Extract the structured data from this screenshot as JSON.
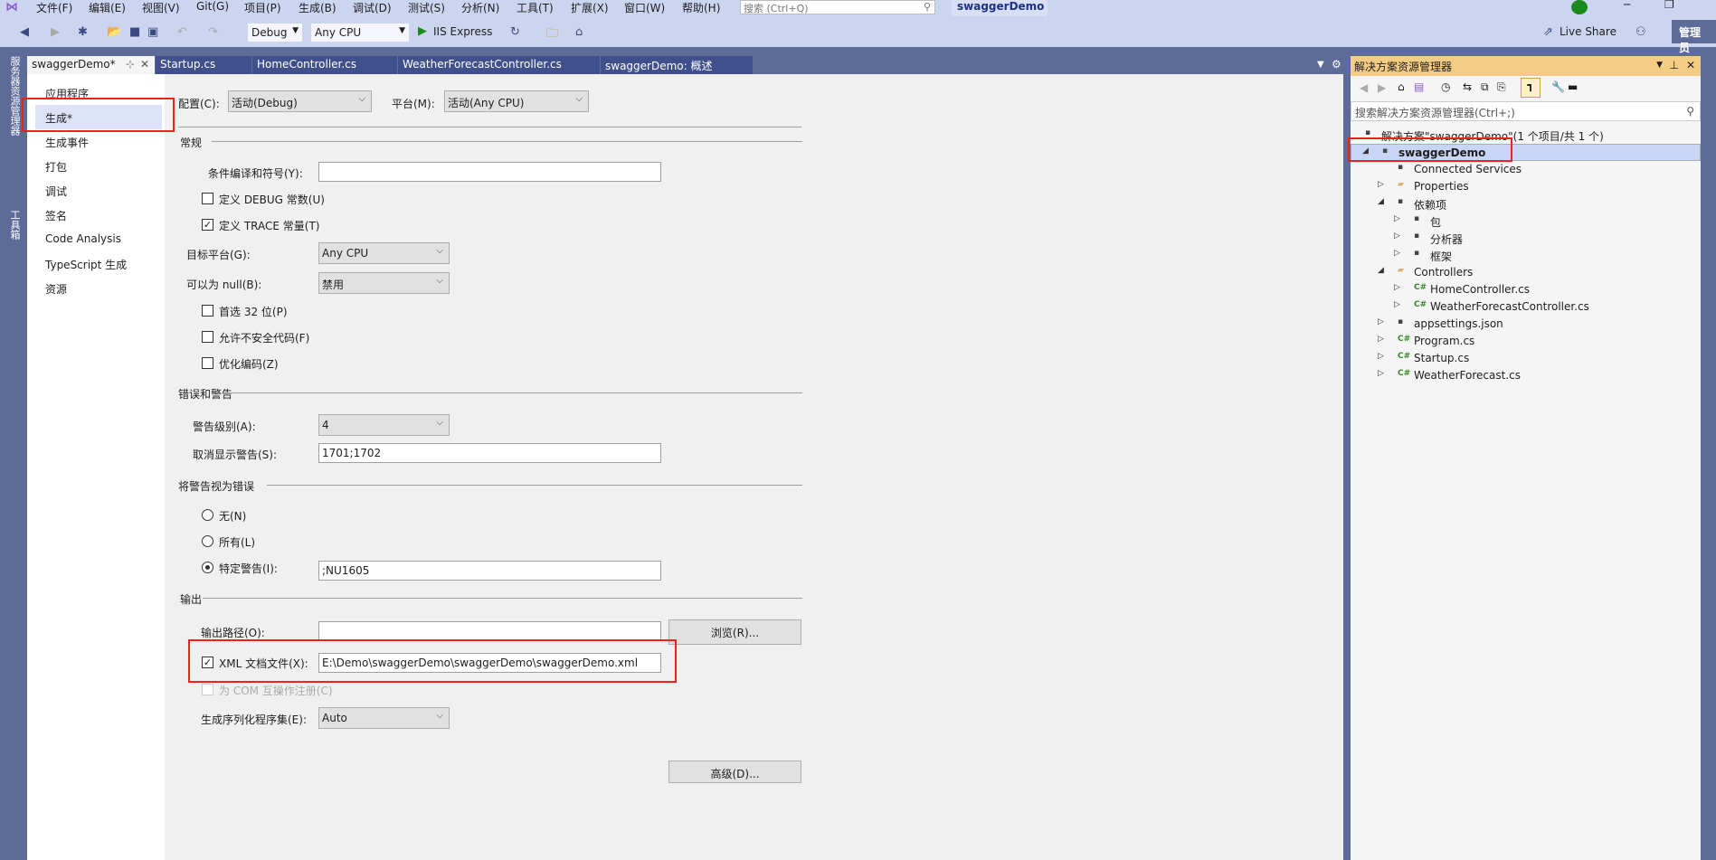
{
  "menu": [
    "文件(F)",
    "编辑(E)",
    "视图(V)",
    "Git(G)",
    "项目(P)",
    "生成(B)",
    "调试(D)",
    "测试(S)",
    "分析(N)",
    "工具(T)",
    "扩展(X)",
    "窗口(W)",
    "帮助(H)"
  ],
  "search_placeholder": "搜索 (Ctrl+Q)",
  "window_title": "swaggerDemo",
  "toolbar": {
    "config": "Debug",
    "platform": "Any CPU",
    "run": "IIS Express",
    "live_share": "Live Share",
    "admin": "管理员"
  },
  "tabs": [
    "swaggerDemo*",
    "Startup.cs",
    "HomeController.cs",
    "WeatherForecastController.cs",
    "swaggerDemo: 概述"
  ],
  "left_bar": [
    "服务器资源管理器",
    "工具箱"
  ],
  "nav": [
    "应用程序",
    "生成*",
    "生成事件",
    "打包",
    "调试",
    "签名",
    "Code Analysis",
    "TypeScript 生成",
    "资源"
  ],
  "nav_selected": "生成*",
  "form": {
    "config_label": "配置(C):",
    "config_value": "活动(Debug)",
    "platform_label": "平台(M):",
    "platform_value": "活动(Any CPU)",
    "general": "常规",
    "cond_label": "条件编译和符号(Y):",
    "cond_value": "",
    "debug_label": "定义 DEBUG 常数(U)",
    "debug_checked": false,
    "trace_label": "定义 TRACE 常量(T)",
    "trace_checked": true,
    "target_label": "目标平台(G):",
    "target_value": "Any CPU",
    "null_label": "可以为 null(B):",
    "null_value": "禁用",
    "prefer32_label": "首选 32 位(P)",
    "prefer32_checked": false,
    "unsafe_label": "允许不安全代码(F)",
    "unsafe_checked": false,
    "optimize_label": "优化编码(Z)",
    "optimize_checked": false,
    "errors": "错误和警告",
    "warnlevel_label": "警告级别(A):",
    "warnlevel_value": "4",
    "suppress_label": "取消显示警告(S):",
    "suppress_value": "1701;1702",
    "treat": "将警告视为错误",
    "none_label": "无(N)",
    "all_label": "所有(L)",
    "specific_label": "特定警告(I):",
    "specific_value": ";NU1605",
    "treat_selected": "特定警告(I):",
    "output": "输出",
    "outpath_label": "输出路径(O):",
    "outpath_value": "",
    "browse": "浏览(R)...",
    "xml_label": "XML 文档文件(X):",
    "xml_checked": true,
    "xml_value": "E:\\Demo\\swaggerDemo\\swaggerDemo\\swaggerDemo.xml",
    "com_label": "为 COM 互操作注册(C)",
    "com_checked": false,
    "serial_label": "生成序列化程序集(E):",
    "serial_value": "Auto",
    "advanced": "高级(D)..."
  },
  "solution_explorer": {
    "title": "解决方案资源管理器",
    "search_placeholder": "搜索解决方案资源管理器(Ctrl+;)",
    "tree": [
      {
        "label": "解决方案\"swaggerDemo\"(1 个项目/共 1 个)",
        "level": 0,
        "icon": "solution-icon",
        "expand": "none"
      },
      {
        "label": "swaggerDemo",
        "level": 0,
        "icon": "web-project-icon",
        "expand": "expanded",
        "selected": true
      },
      {
        "label": "Connected Services",
        "level": 1,
        "icon": "connected-services-icon",
        "expand": "none"
      },
      {
        "label": "Properties",
        "level": 1,
        "icon": "properties-folder-icon",
        "expand": "collapsed"
      },
      {
        "label": "依赖项",
        "level": 1,
        "icon": "dependencies-icon",
        "expand": "expanded"
      },
      {
        "label": "包",
        "level": 2,
        "icon": "package-icon",
        "expand": "collapsed"
      },
      {
        "label": "分析器",
        "level": 2,
        "icon": "analyzer-icon",
        "expand": "collapsed"
      },
      {
        "label": "框架",
        "level": 2,
        "icon": "framework-icon",
        "expand": "collapsed"
      },
      {
        "label": "Controllers",
        "level": 1,
        "icon": "folder-icon",
        "expand": "expanded"
      },
      {
        "label": "HomeController.cs",
        "level": 2,
        "icon": "csharp-file-icon",
        "expand": "collapsed"
      },
      {
        "label": "WeatherForecastController.cs",
        "level": 2,
        "icon": "csharp-file-icon",
        "expand": "collapsed"
      },
      {
        "label": "appsettings.json",
        "level": 1,
        "icon": "json-file-icon",
        "expand": "collapsed"
      },
      {
        "label": "Program.cs",
        "level": 1,
        "icon": "csharp-file-icon",
        "expand": "collapsed"
      },
      {
        "label": "Startup.cs",
        "level": 1,
        "icon": "csharp-file-icon",
        "expand": "collapsed"
      },
      {
        "label": "WeatherForecast.cs",
        "level": 1,
        "icon": "csharp-file-icon",
        "expand": "collapsed"
      }
    ]
  },
  "colors": {
    "highlight": "#f0201a",
    "accent": "#5d6b99",
    "se_header": "#f5cc84"
  }
}
